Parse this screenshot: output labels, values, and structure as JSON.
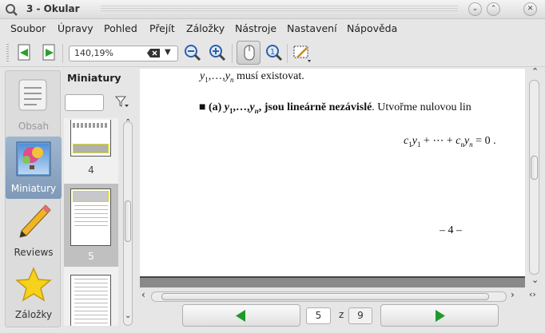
{
  "window": {
    "title": "3 - Okular",
    "controls": {
      "minimize": "⌄",
      "maximize": "⌃",
      "close": "✕"
    }
  },
  "menu": [
    "Soubor",
    "Úpravy",
    "Pohled",
    "Přejít",
    "Záložky",
    "Nástroje",
    "Nastavení",
    "Nápověda"
  ],
  "toolbar": {
    "zoom_value": "140,19%",
    "icons": [
      "page-previous-icon",
      "page-next-icon",
      "clear-icon",
      "zoom-out-icon",
      "zoom-in-icon",
      "browse-mouse-icon",
      "zoom-tool-icon",
      "selection-tool-icon"
    ]
  },
  "sidebar": {
    "items": [
      {
        "label": "Obsah",
        "icon": "contents-icon",
        "state": "disabled"
      },
      {
        "label": "Miniatury",
        "icon": "thumbnails-icon",
        "state": "active"
      },
      {
        "label": "Reviews",
        "icon": "pencil-icon",
        "state": "normal"
      },
      {
        "label": "Záložky",
        "icon": "star-icon",
        "state": "normal"
      }
    ]
  },
  "thumbnails": {
    "title": "Miniatury",
    "pages": [
      "4",
      "5"
    ],
    "selected_page": "5"
  },
  "document": {
    "line1_var": "y",
    "line1_sub1": "1",
    "line1_mid": ",…,",
    "line1_var2": "y",
    "line1_sub2": "n",
    "line1_text": " musí existovat.",
    "bullet": "■",
    "line2_bold_a": " (a) ",
    "line2_bold_y": "y",
    "line2_bold_sub1": "1",
    "line2_bold_mid": ",…,",
    "line2_bold_y2": "y",
    "line2_bold_sub2": "n",
    "line2_bold_rest": ", jsou lineárně nezávislé",
    "line2_text": ". Utvořme nulovou lin",
    "eq_c": "c",
    "eq_sub1": "1",
    "eq_y": "y",
    "eq_sub1b": "1",
    "eq_mid": " + ⋯ + ",
    "eq_c2": "c",
    "eq_subn": "n",
    "eq_y2": "y",
    "eq_subnb": "n",
    "eq_end": " = 0 .",
    "page_number": "– 4 –"
  },
  "navigation": {
    "current_page": "5",
    "of_label": "z",
    "total_pages": "9"
  },
  "colors": {
    "accent": "#8aa4c0",
    "nav_arrow": "#1e9a2a"
  }
}
